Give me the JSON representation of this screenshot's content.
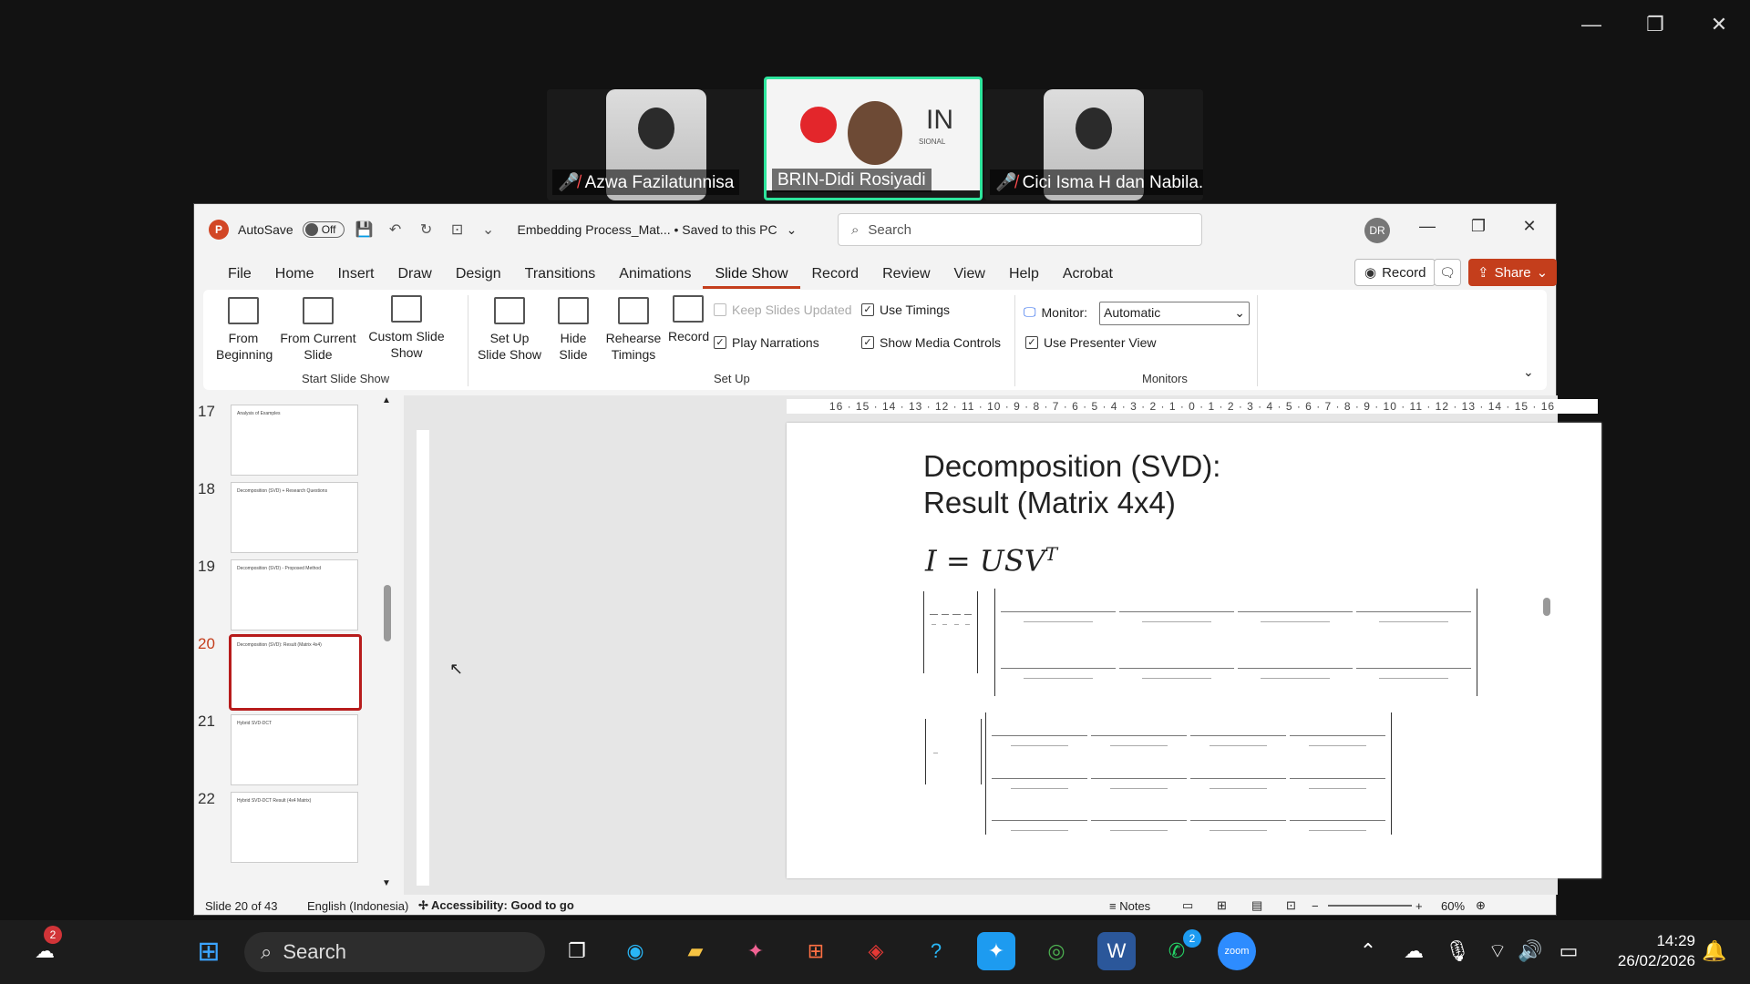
{
  "meeting": {
    "participants": [
      {
        "name": "Azwa Fazilatunnisa",
        "muted": true
      },
      {
        "name": "BRIN-Didi Rosiyadi",
        "muted": false,
        "active": true
      },
      {
        "name": "Cici Isma H dan Nabila...",
        "muted": true
      }
    ],
    "logo_text": "IN",
    "logo_sub": "SIONAL"
  },
  "ppt": {
    "autosave_label": "AutoSave",
    "autosave_state": "Off",
    "doc_title": "Embedding Process_Mat... • Saved to this PC",
    "search_placeholder": "Search",
    "user_initials": "DR",
    "tabs": [
      "File",
      "Home",
      "Insert",
      "Draw",
      "Design",
      "Transitions",
      "Animations",
      "Slide Show",
      "Record",
      "Review",
      "View",
      "Help",
      "Acrobat"
    ],
    "selected_tab": "Slide Show",
    "record_button": "Record",
    "share_button": "Share",
    "ribbon": {
      "from_beginning": "From Beginning",
      "from_current": "From Current Slide",
      "custom_show": "Custom Slide Show",
      "start_group": "Start Slide Show",
      "set_up_show": "Set Up Slide Show",
      "hide_slide": "Hide Slide",
      "rehearse": "Rehearse Timings",
      "record": "Record",
      "keep_updated": "Keep Slides Updated",
      "play_narrations": "Play Narrations",
      "use_timings": "Use Timings",
      "show_media": "Show Media Controls",
      "setup_group": "Set Up",
      "monitor_label": "Monitor:",
      "monitor_value": "Automatic",
      "presenter_view": "Use Presenter View",
      "monitors_group": "Monitors"
    },
    "thumbnails": [
      {
        "num": "17",
        "title": "Analysis of Examples"
      },
      {
        "num": "18",
        "title": "Decomposition (SVD) + Research Questions"
      },
      {
        "num": "19",
        "title": "Decomposition (SVD) - Proposed Method"
      },
      {
        "num": "20",
        "title": "Decomposition (SVD): Result (Matrix 4x4)"
      },
      {
        "num": "21",
        "title": "Hybrid SVD-DCT"
      },
      {
        "num": "22",
        "title": "Hybrid SVD-DCT Result (4x4 Matrix)"
      }
    ],
    "selected_slide": "20",
    "ruler_numbers": "16 · 15 · 14 · 13 · 12 · 11 · 10 · 9 · 8 · 7 · 6 · 5 · 4 · 3 · 2 · 1 · 0 · 1 · 2 · 3 · 4 · 5 · 6 · 7 · 8 · 9 · 10 · 11 · 12 · 13 · 14 · 15 · 16",
    "slide": {
      "title_line1": "Decomposition (SVD):",
      "title_line2": "Result (Matrix 4x4)",
      "equation": "I = USV",
      "equation_sup": "T"
    },
    "status": {
      "slide_info": "Slide 20 of 43",
      "language": "English (Indonesia)",
      "accessibility": "Accessibility: Good to go",
      "notes": "Notes",
      "zoom": "60%"
    }
  },
  "taskbar": {
    "search_label": "Search",
    "weather_badge": "2",
    "whatsapp_badge": "2",
    "time": "14:29",
    "date": "26/02/2026"
  },
  "colors": {
    "accent": "#c43e1c",
    "active_speaker": "#2ee59d",
    "taskbar": "#1c1c1c"
  }
}
